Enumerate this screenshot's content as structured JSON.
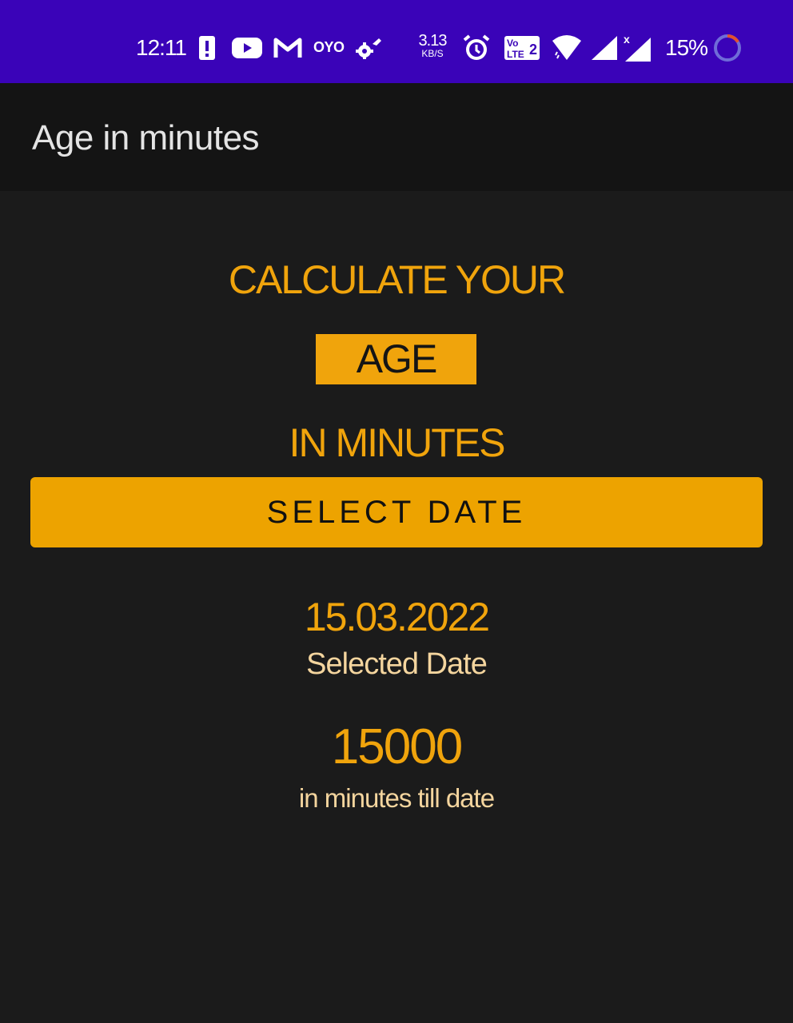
{
  "status_bar": {
    "time": "12:11",
    "net_speed_value": "3.13",
    "net_speed_unit": "KB/S",
    "battery_percent": "15%",
    "colors": {
      "background": "#3a03b8",
      "battery_ring_track": "#6f6cd8",
      "battery_ring_fill": "#e2502f"
    },
    "icons": [
      "alert-icon",
      "youtube-icon",
      "gmail-icon",
      "oyo-icon",
      "settings-gear-icon",
      "alarm-clock-icon",
      "volte-icon",
      "wifi-icon",
      "signal-icon",
      "signal-no-data-icon",
      "battery-ring-icon"
    ],
    "oyo_label": "OYO",
    "volte_label": "Vo LTE 2"
  },
  "app_bar": {
    "title": "Age in minutes"
  },
  "main": {
    "heading_line1": "CALCULATE YOUR",
    "heading_highlight": "AGE",
    "heading_line3": "IN MINUTES",
    "select_button_label": "SELECT DATE",
    "selected_date_value": "15.03.2022",
    "selected_date_label": "Selected Date",
    "minutes_value": "15000",
    "minutes_label": "in minutes till date"
  },
  "colors": {
    "accent": "#f0a40c",
    "label": "#f4d59e",
    "app_bar": "#141414",
    "background": "#1b1b1b"
  }
}
